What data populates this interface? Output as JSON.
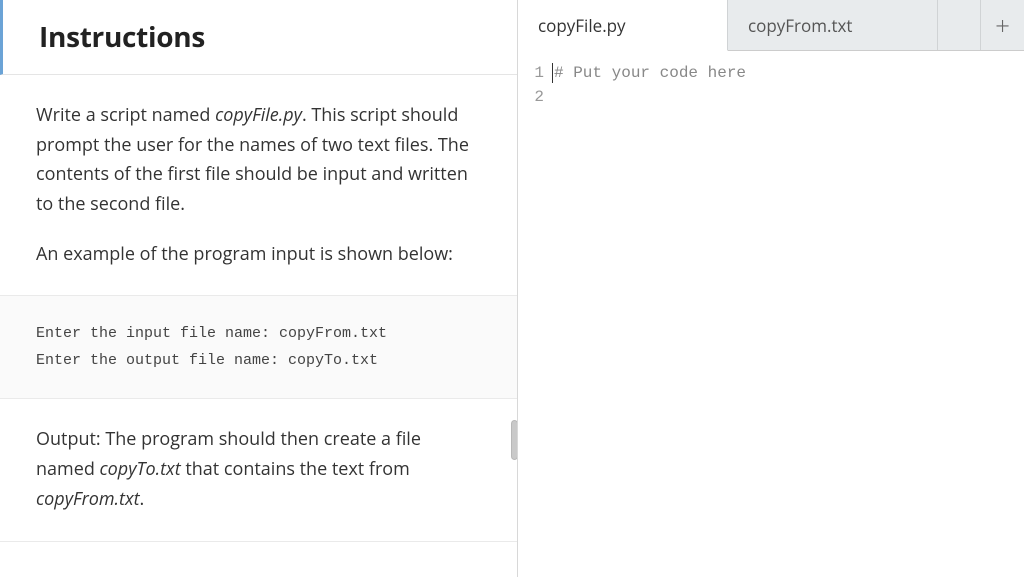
{
  "instructions": {
    "heading": "Instructions",
    "section1": {
      "prefix": "Write a script named ",
      "filename": "copyFile.py",
      "suffix": ". This script should prompt the user for the names of two text files. The contents of the first file should be input and written to the second file.",
      "example_intro": "An example of the program input is shown below:"
    },
    "code_example": "Enter the input file name: copyFrom.txt\nEnter the output file name: copyTo.txt",
    "section2": {
      "output_prefix": "Output: The program should then create a file named ",
      "file_out": "copyTo.txt",
      "middle": " that contains the text from ",
      "file_in": "copyFrom.txt",
      "end": "."
    }
  },
  "tabs": {
    "active": "copyFile.py",
    "inactive": "copyFrom.txt",
    "add_label": "+"
  },
  "editor": {
    "line_numbers": [
      "1",
      "2"
    ],
    "line1_comment": "# Put your code here"
  }
}
